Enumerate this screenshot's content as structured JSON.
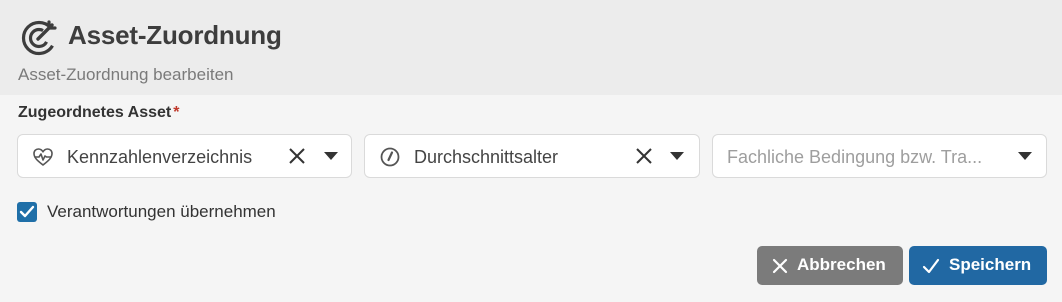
{
  "header": {
    "title": "Asset-Zuordnung",
    "subtitle": "Asset-Zuordnung bearbeiten",
    "icon": "target-arrow-icon"
  },
  "form": {
    "field_label": "Zugeordnetes Asset",
    "required_marker": "*",
    "selects": [
      {
        "icon": "heart-pulse-icon",
        "value": "Kennzahlenverzeichnis",
        "clearable": true
      },
      {
        "icon": "gauge-icon",
        "value": "Durchschnittsalter",
        "clearable": true
      },
      {
        "placeholder": "Fachliche Bedingung bzw. Tra..."
      }
    ],
    "checkbox": {
      "label": "Verantwortungen übernehmen",
      "checked": true
    }
  },
  "actions": {
    "cancel_label": "Abbrechen",
    "save_label": "Speichern"
  },
  "colors": {
    "accent": "#2168a3",
    "cancel": "#7b7b7b",
    "required": "#c0392b"
  }
}
